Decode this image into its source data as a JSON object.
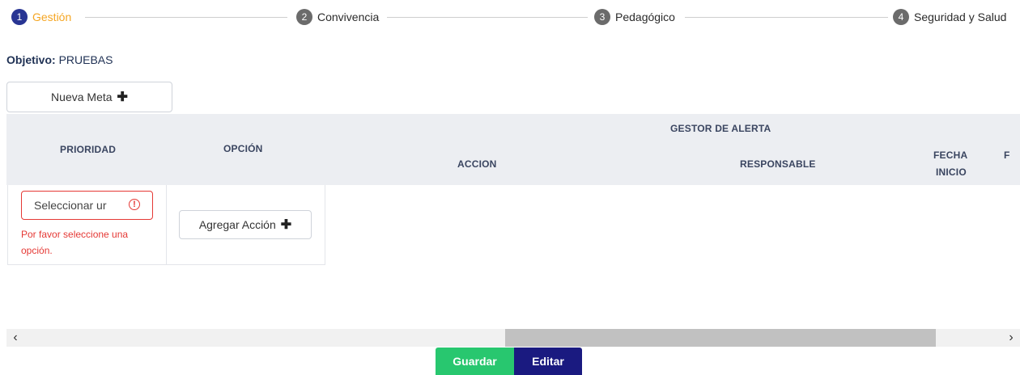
{
  "stepper": {
    "steps": [
      {
        "num": "1",
        "label": "Gestión"
      },
      {
        "num": "2",
        "label": "Convivencia"
      },
      {
        "num": "3",
        "label": "Pedagógico"
      },
      {
        "num": "4",
        "label": "Seguridad y Salud"
      }
    ],
    "active_step": 1
  },
  "objective": {
    "label": "Objetivo:",
    "value": "PRUEBAS"
  },
  "new_goal_button": {
    "label": "Nueva Meta",
    "icon": "plus-icon"
  },
  "table": {
    "headers": {
      "priority": "PRIORIDAD",
      "option": "OPCIÓN",
      "alert_manager": "GESTOR DE ALERTA",
      "action": "ACCION",
      "responsible": "RESPONSABLE",
      "start_date_line1": "FECHA",
      "start_date_line2": "INICIO",
      "next_col_partial": "F"
    },
    "row": {
      "priority_select_value": "Seleccionar ur",
      "priority_error": "Por favor seleccione una opción.",
      "add_action_label": "Agregar Acción"
    }
  },
  "scrollbar": {
    "left_arrow": "‹",
    "right_arrow": "›"
  },
  "actions": {
    "save": "Guardar",
    "edit": "Editar"
  },
  "colors": {
    "active_step": "#283593",
    "active_label": "#f5a623",
    "error": "#e53935",
    "save": "#28c76f",
    "edit": "#1a1a80"
  }
}
